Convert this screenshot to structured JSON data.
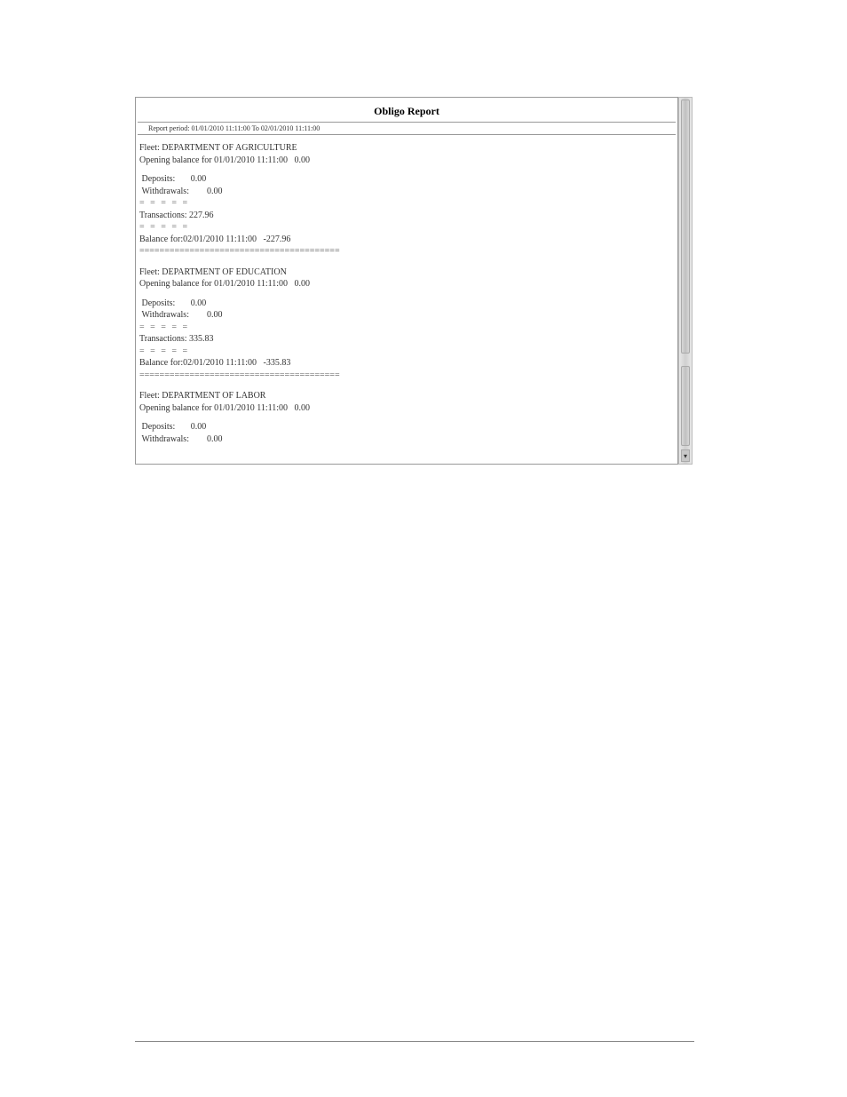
{
  "report": {
    "title": "Obligo Report",
    "period_label": "Report period:",
    "period_value": "01/01/2010 11:11:00 To 02/01/2010 11:11:00"
  },
  "separators": {
    "dashes": "= = = = =",
    "equals": "========================================"
  },
  "labels": {
    "fleet_prefix": "Fleet: ",
    "opening_prefix": "Opening balance for ",
    "deposits": "Deposits:",
    "withdrawals": "Withdrawals:",
    "transactions": "Transactions: ",
    "balance_prefix": "Balance for:"
  },
  "fleets": [
    {
      "name": "DEPARTMENT OF AGRICULTURE",
      "opening_date": "01/01/2010 11:11:00",
      "opening_value": "0.00",
      "deposits": "0.00",
      "withdrawals": "0.00",
      "transactions": "227.96",
      "balance_date": "02/01/2010 11:11:00",
      "balance_value": "-227.96"
    },
    {
      "name": "DEPARTMENT OF EDUCATION",
      "opening_date": "01/01/2010 11:11:00",
      "opening_value": "0.00",
      "deposits": "0.00",
      "withdrawals": "0.00",
      "transactions": "335.83",
      "balance_date": "02/01/2010 11:11:00",
      "balance_value": "-335.83"
    },
    {
      "name": "DEPARTMENT OF LABOR",
      "opening_date": "01/01/2010 11:11:00",
      "opening_value": "0.00",
      "deposits": "0.00",
      "withdrawals": "0.00"
    }
  ]
}
